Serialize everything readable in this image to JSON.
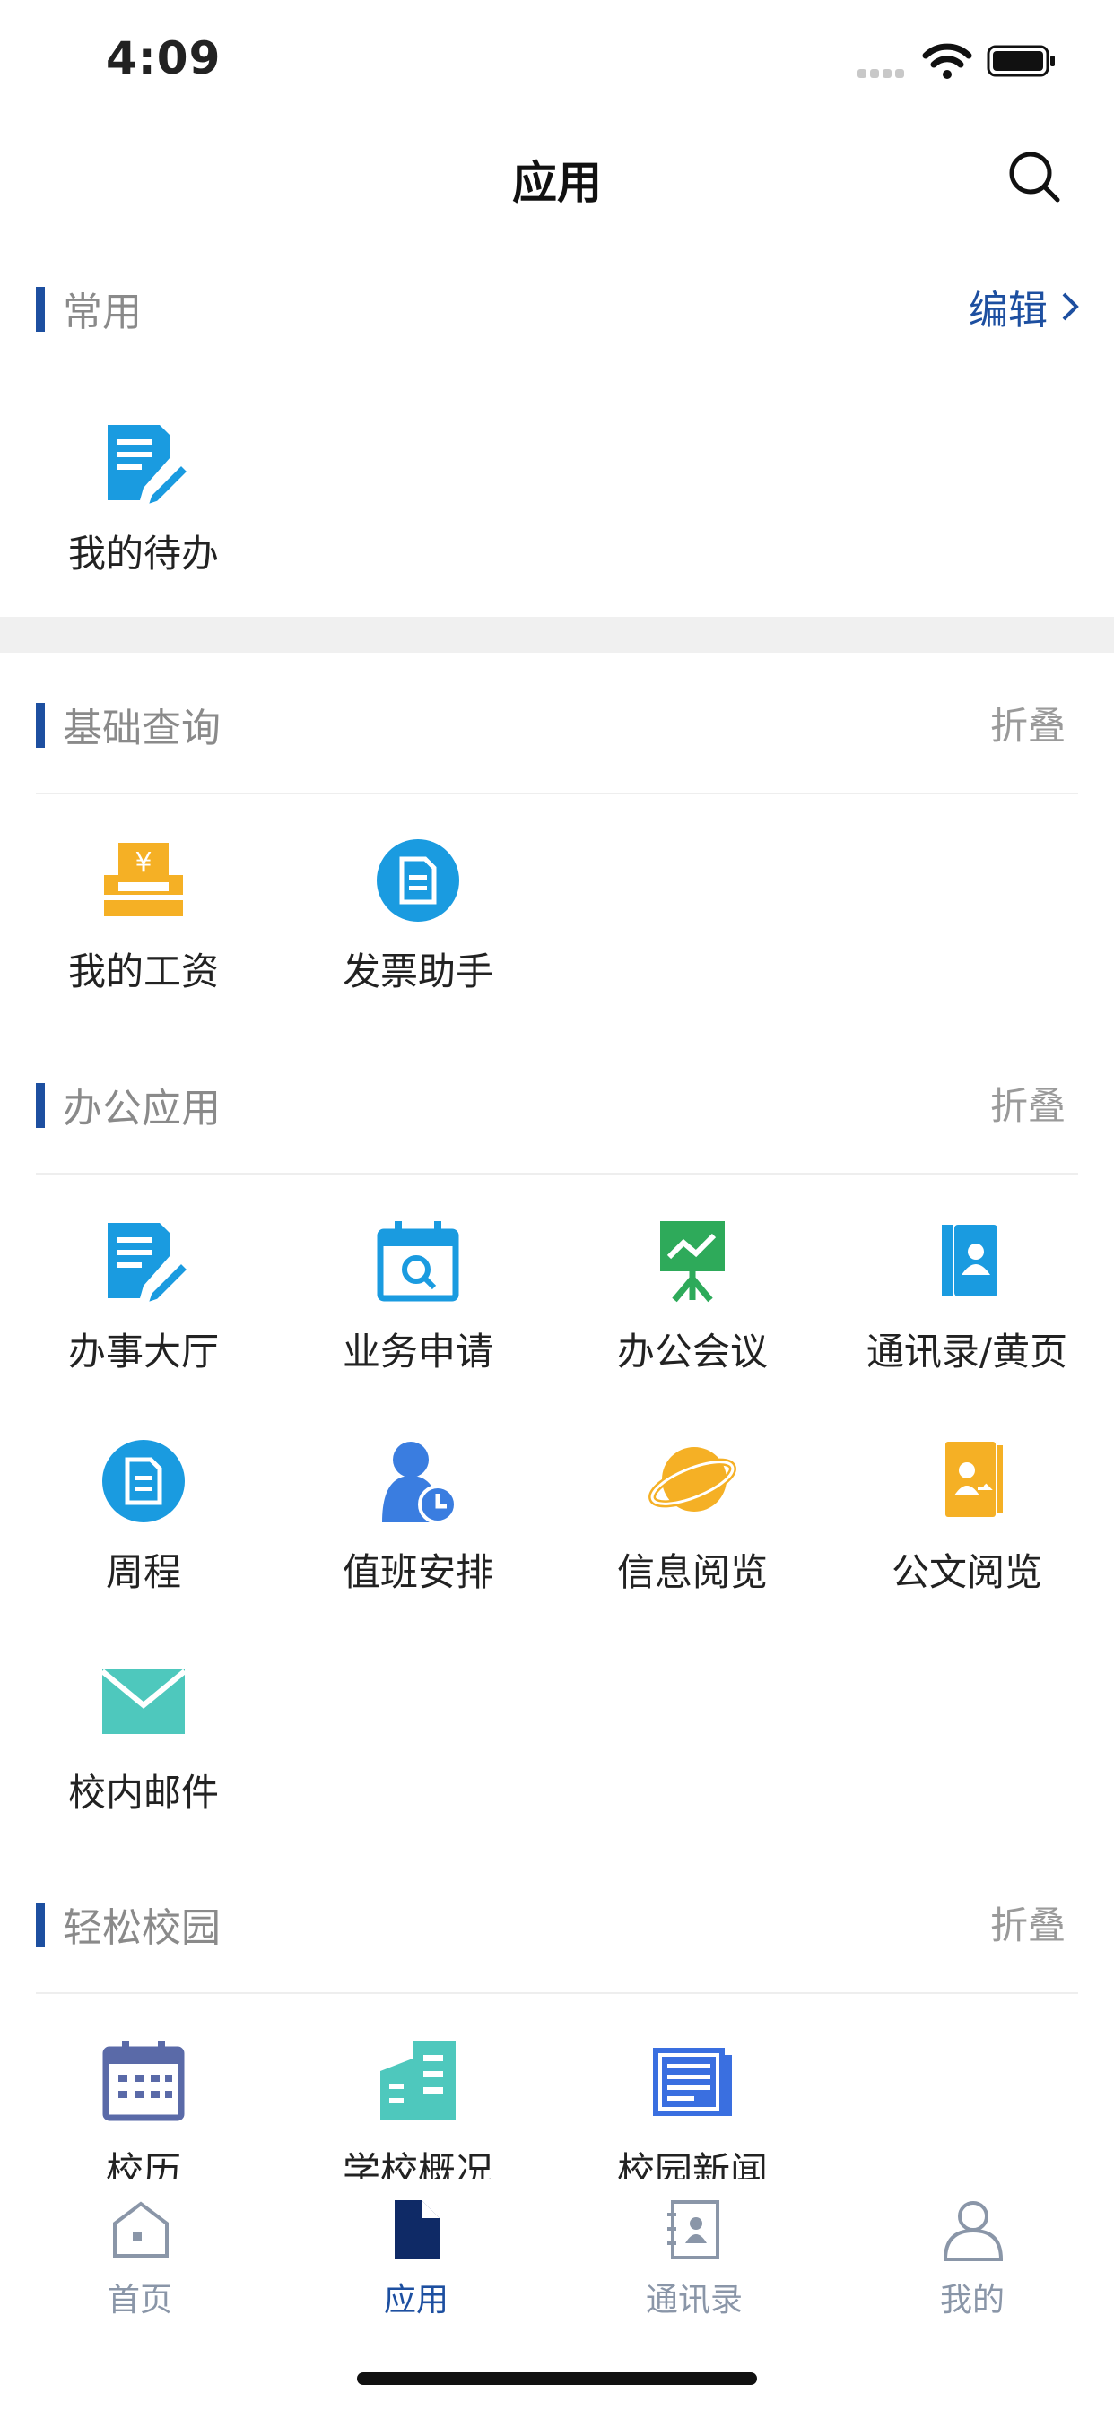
{
  "status": {
    "time": "4:09"
  },
  "header": {
    "title": "应用"
  },
  "sections": {
    "common": {
      "title": "常用",
      "action": "编辑"
    },
    "basic": {
      "title": "基础查询",
      "action": "折叠"
    },
    "office": {
      "title": "办公应用",
      "action": "折叠"
    },
    "campus": {
      "title": "轻松校园",
      "action": "折叠"
    }
  },
  "apps": {
    "todo": "我的待办",
    "salary": "我的工资",
    "invoice": "发票助手",
    "hall": "办事大厅",
    "business": "业务申请",
    "meeting": "办公会议",
    "contacts": "通讯录/黄页",
    "weekly": "周程",
    "duty": "值班安排",
    "info": "信息阅览",
    "docs": "公文阅览",
    "mail": "校内邮件",
    "calendar": "校历",
    "school": "学校概况",
    "news": "校园新闻"
  },
  "tabs": [
    {
      "label": "首页",
      "icon": "home-icon"
    },
    {
      "label": "应用",
      "icon": "document-icon"
    },
    {
      "label": "通讯录",
      "icon": "contacts-book-icon"
    },
    {
      "label": "我的",
      "icon": "user-icon"
    }
  ],
  "colors": {
    "accent": "#1d4fa0",
    "icon_blue": "#1a9be0",
    "icon_orange": "#f5b025",
    "icon_green": "#2eaa5a",
    "icon_teal": "#4ec8bd",
    "icon_navy": "#5a6aa8"
  }
}
